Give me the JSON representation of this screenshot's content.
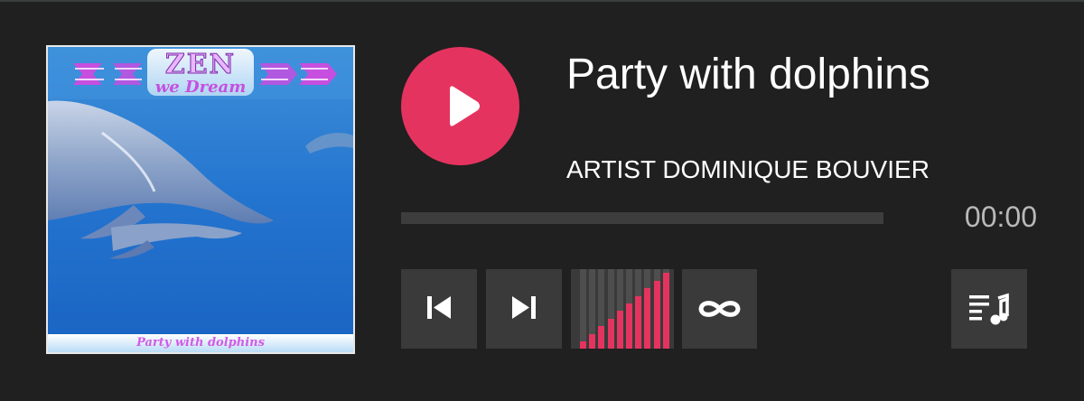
{
  "track": {
    "title": "Party with dolphins",
    "artist": "ARTIST DOMINIQUE BOUVIER",
    "time": "00:00",
    "progress": 0
  },
  "cover": {
    "banner_title": "ZEN",
    "banner_subtitle": "we Dream",
    "caption": "Party with dolphins"
  },
  "controls": {
    "play_icon": "play-icon",
    "prev_icon": "skip-previous-icon",
    "next_icon": "skip-next-icon",
    "repeat_icon": "repeat-infinity-icon",
    "playlist_icon": "playlist-music-icon",
    "volume_level": 1.0,
    "volume_bars": 10
  },
  "colors": {
    "background": "#202020",
    "accent": "#e5335f",
    "button": "#3a3a3a",
    "track": "#3d3d3d",
    "time_text": "#b9b9b9"
  }
}
